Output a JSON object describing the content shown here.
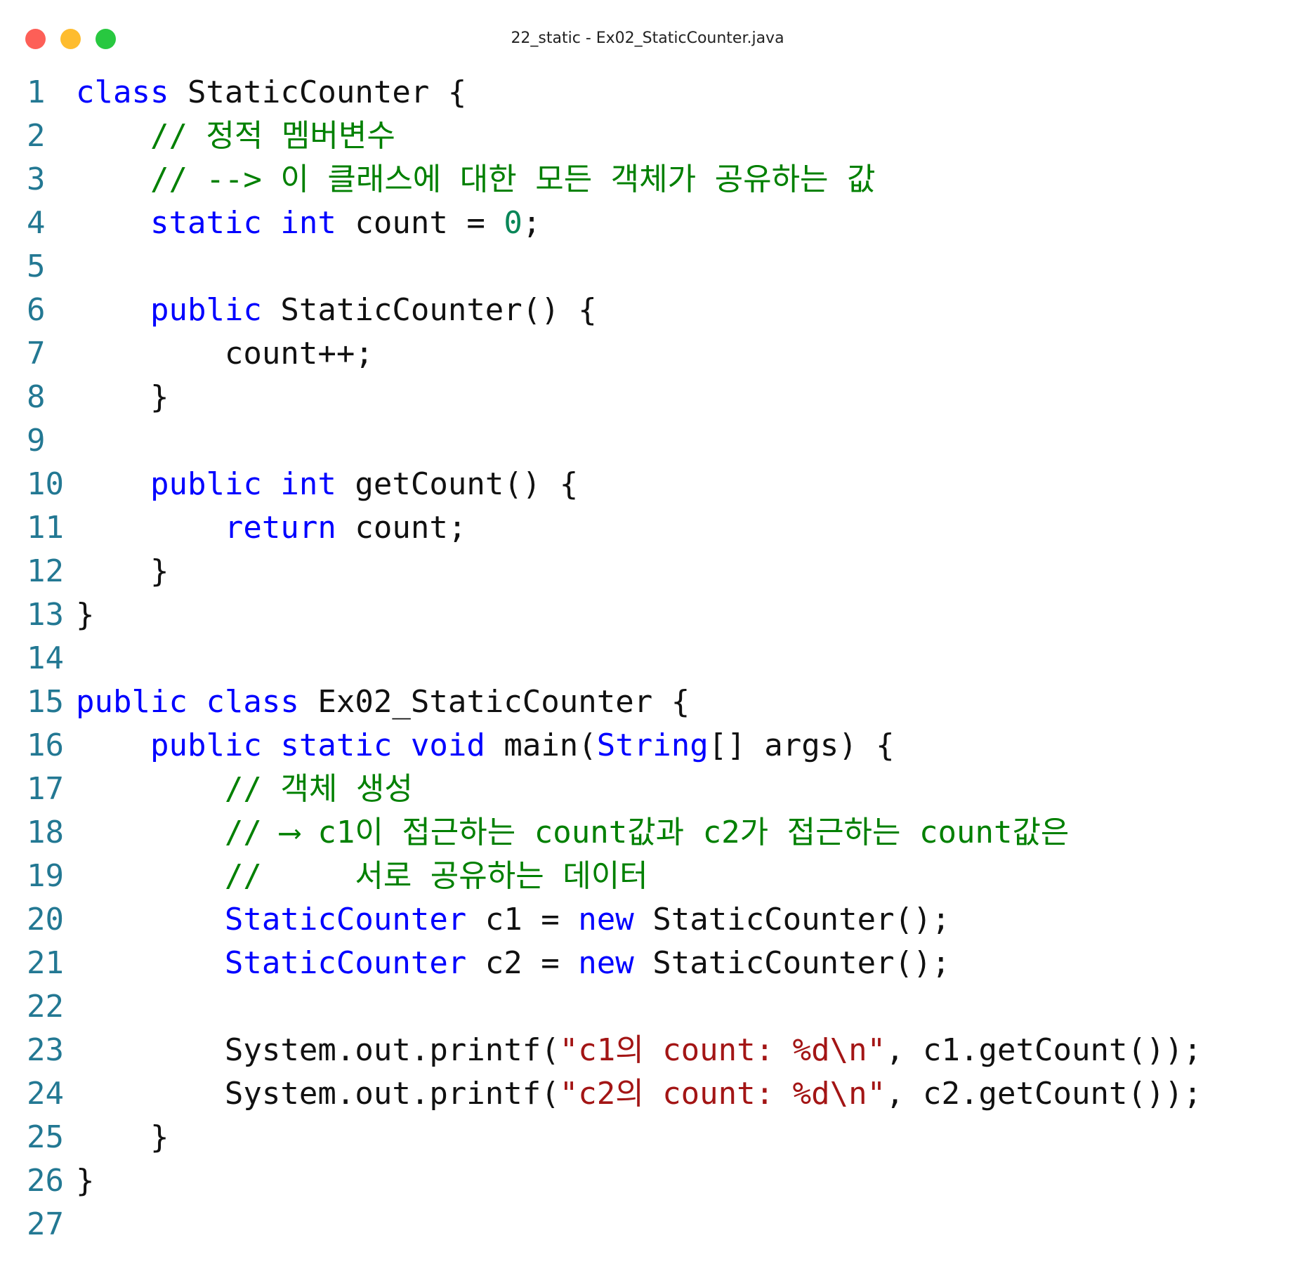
{
  "window": {
    "title": "22_static - Ex02_StaticCounter.java",
    "colors": {
      "close": "#fd5f57",
      "minimize": "#febc2e",
      "zoom": "#28c840",
      "keyword": "#0000ff",
      "comment": "#008000",
      "number": "#098658",
      "string": "#a31515",
      "line_number": "#237893"
    }
  },
  "editor": {
    "lines": [
      {
        "n": "1",
        "tokens": [
          {
            "t": "class",
            "c": "kw"
          },
          {
            "t": " StaticCounter {",
            "c": "plain"
          }
        ]
      },
      {
        "n": "2",
        "tokens": [
          {
            "t": "    // 정적 멤버변수",
            "c": "com"
          }
        ]
      },
      {
        "n": "3",
        "tokens": [
          {
            "t": "    // --> 이 클래스에 대한 모든 객체가 공유하는 값",
            "c": "com"
          }
        ]
      },
      {
        "n": "4",
        "tokens": [
          {
            "t": "    ",
            "c": "plain"
          },
          {
            "t": "static",
            "c": "kw"
          },
          {
            "t": " ",
            "c": "plain"
          },
          {
            "t": "int",
            "c": "kw"
          },
          {
            "t": " count = ",
            "c": "plain"
          },
          {
            "t": "0",
            "c": "num"
          },
          {
            "t": ";",
            "c": "plain"
          }
        ]
      },
      {
        "n": "5",
        "tokens": []
      },
      {
        "n": "6",
        "tokens": [
          {
            "t": "    ",
            "c": "plain"
          },
          {
            "t": "public",
            "c": "kw"
          },
          {
            "t": " StaticCounter() {",
            "c": "plain"
          }
        ]
      },
      {
        "n": "7",
        "tokens": [
          {
            "t": "        count++;",
            "c": "plain"
          }
        ]
      },
      {
        "n": "8",
        "tokens": [
          {
            "t": "    }",
            "c": "plain"
          }
        ]
      },
      {
        "n": "9",
        "tokens": []
      },
      {
        "n": "10",
        "tokens": [
          {
            "t": "    ",
            "c": "plain"
          },
          {
            "t": "public",
            "c": "kw"
          },
          {
            "t": " ",
            "c": "plain"
          },
          {
            "t": "int",
            "c": "kw"
          },
          {
            "t": " getCount() {",
            "c": "plain"
          }
        ]
      },
      {
        "n": "11",
        "tokens": [
          {
            "t": "        ",
            "c": "plain"
          },
          {
            "t": "return",
            "c": "kw"
          },
          {
            "t": " count;",
            "c": "plain"
          }
        ]
      },
      {
        "n": "12",
        "tokens": [
          {
            "t": "    }",
            "c": "plain"
          }
        ]
      },
      {
        "n": "13",
        "tokens": [
          {
            "t": "}",
            "c": "plain"
          }
        ]
      },
      {
        "n": "14",
        "tokens": []
      },
      {
        "n": "15",
        "tokens": [
          {
            "t": "public",
            "c": "kw"
          },
          {
            "t": " ",
            "c": "plain"
          },
          {
            "t": "class",
            "c": "kw"
          },
          {
            "t": " Ex02_StaticCounter {",
            "c": "plain"
          }
        ]
      },
      {
        "n": "16",
        "tokens": [
          {
            "t": "    ",
            "c": "plain"
          },
          {
            "t": "public",
            "c": "kw"
          },
          {
            "t": " ",
            "c": "plain"
          },
          {
            "t": "static",
            "c": "kw"
          },
          {
            "t": " ",
            "c": "plain"
          },
          {
            "t": "void",
            "c": "kw"
          },
          {
            "t": " main(",
            "c": "plain"
          },
          {
            "t": "String",
            "c": "kw"
          },
          {
            "t": "[] args) {",
            "c": "plain"
          }
        ]
      },
      {
        "n": "17",
        "tokens": [
          {
            "t": "        // 객체 생성",
            "c": "com"
          }
        ]
      },
      {
        "n": "18",
        "tokens": [
          {
            "t": "        // ⟶ c1이 접근하는 count값과 c2가 접근하는 count값은",
            "c": "com"
          }
        ]
      },
      {
        "n": "19",
        "tokens": [
          {
            "t": "        //     서로 공유하는 데이터",
            "c": "com"
          }
        ]
      },
      {
        "n": "20",
        "tokens": [
          {
            "t": "        ",
            "c": "plain"
          },
          {
            "t": "StaticCounter",
            "c": "kw"
          },
          {
            "t": " c1 = ",
            "c": "plain"
          },
          {
            "t": "new",
            "c": "kw"
          },
          {
            "t": " StaticCounter();",
            "c": "plain"
          }
        ]
      },
      {
        "n": "21",
        "tokens": [
          {
            "t": "        ",
            "c": "plain"
          },
          {
            "t": "StaticCounter",
            "c": "kw"
          },
          {
            "t": " c2 = ",
            "c": "plain"
          },
          {
            "t": "new",
            "c": "kw"
          },
          {
            "t": " StaticCounter();",
            "c": "plain"
          }
        ]
      },
      {
        "n": "22",
        "tokens": []
      },
      {
        "n": "23",
        "tokens": [
          {
            "t": "        System.out.printf(",
            "c": "plain"
          },
          {
            "t": "\"c1의 count: %d\\n\"",
            "c": "str"
          },
          {
            "t": ", c1.getCount());",
            "c": "plain"
          }
        ]
      },
      {
        "n": "24",
        "tokens": [
          {
            "t": "        System.out.printf(",
            "c": "plain"
          },
          {
            "t": "\"c2의 count: %d\\n\"",
            "c": "str"
          },
          {
            "t": ", c2.getCount());",
            "c": "plain"
          }
        ]
      },
      {
        "n": "25",
        "tokens": [
          {
            "t": "    }",
            "c": "plain"
          }
        ]
      },
      {
        "n": "26",
        "tokens": [
          {
            "t": "}",
            "c": "plain"
          }
        ]
      },
      {
        "n": "27",
        "tokens": []
      }
    ]
  }
}
